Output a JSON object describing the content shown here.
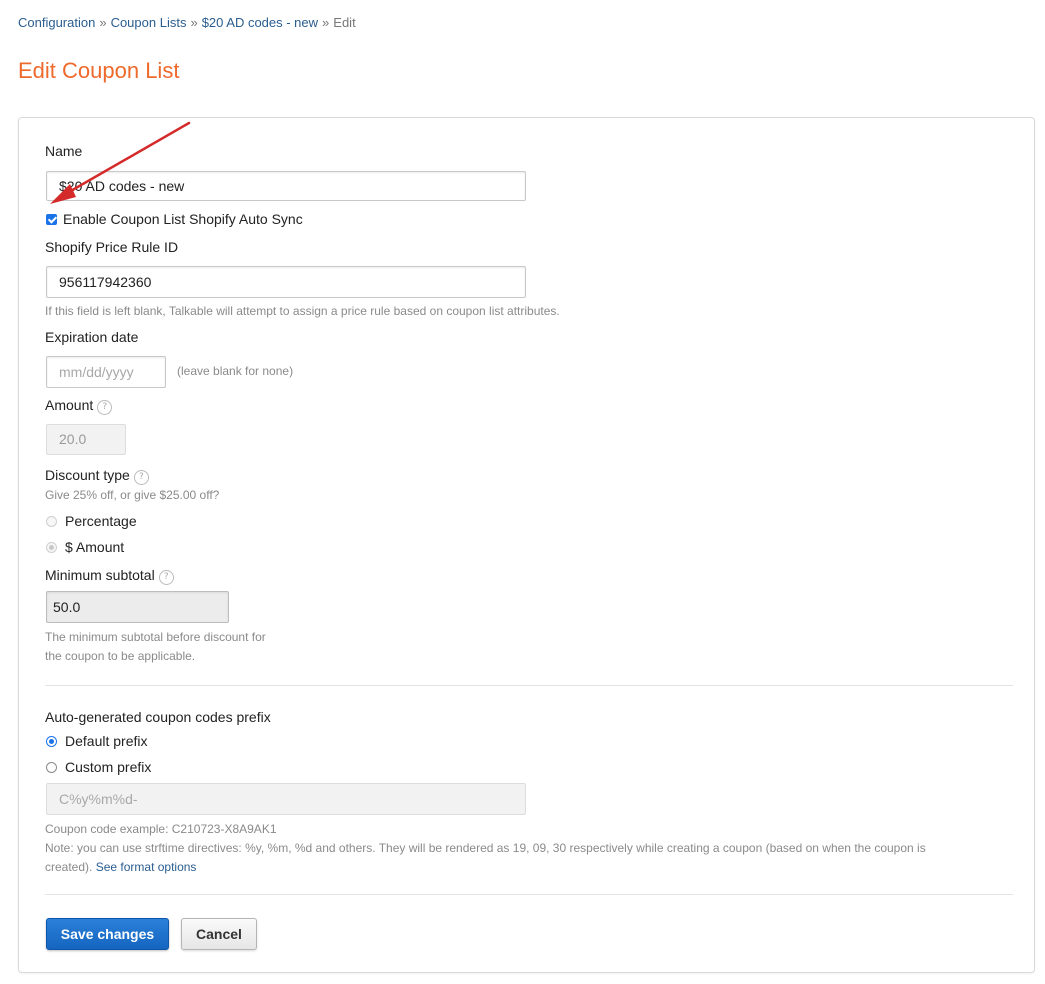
{
  "breadcrumb": {
    "items": [
      "Configuration",
      "Coupon Lists",
      "$20 AD codes - new"
    ],
    "current": "Edit",
    "separator": "»"
  },
  "page_title": "Edit Coupon List",
  "form": {
    "name": {
      "label": "Name",
      "value": "$20 AD codes - new"
    },
    "auto_sync": {
      "label": "Enable Coupon List Shopify Auto Sync",
      "checked": true
    },
    "price_rule": {
      "label": "Shopify Price Rule ID",
      "value": "956117942360",
      "help": "If this field is left blank, Talkable will attempt to assign a price rule based on coupon list attributes."
    },
    "expiration": {
      "label": "Expiration date",
      "placeholder": "mm/dd/yyyy",
      "hint": "(leave blank for none)"
    },
    "amount": {
      "label": "Amount",
      "value": "20.0"
    },
    "discount_type": {
      "label": "Discount type",
      "help": "Give 25% off, or give $25.00 off?",
      "options": [
        "Percentage",
        "$ Amount"
      ],
      "selected": "$ Amount"
    },
    "min_subtotal": {
      "label": "Minimum subtotal",
      "value": "50.0",
      "help_line1": "The minimum subtotal before discount for",
      "help_line2": "the coupon to be applicable."
    },
    "prefix": {
      "label": "Auto-generated coupon codes prefix",
      "options": [
        "Default prefix",
        "Custom prefix"
      ],
      "selected": "Default prefix",
      "custom_placeholder": "C%y%m%d-",
      "example": "Coupon code example: C210723-X8A9AK1",
      "note_line1": "Note: you can use strftime directives: %y, %m, %d and others. They will be rendered as 19, 09, 30 respectively while creating a coupon (based on when the coupon is",
      "note_line2": "created).",
      "note_link": "See format options"
    },
    "help_icon": "question-icon",
    "save_label": "Save changes",
    "cancel_label": "Cancel"
  },
  "colors": {
    "title": "#ee6a2c",
    "link": "#2a5d8f",
    "primary": "#1a73e8",
    "annotation_arrow": "#d42a2a"
  }
}
